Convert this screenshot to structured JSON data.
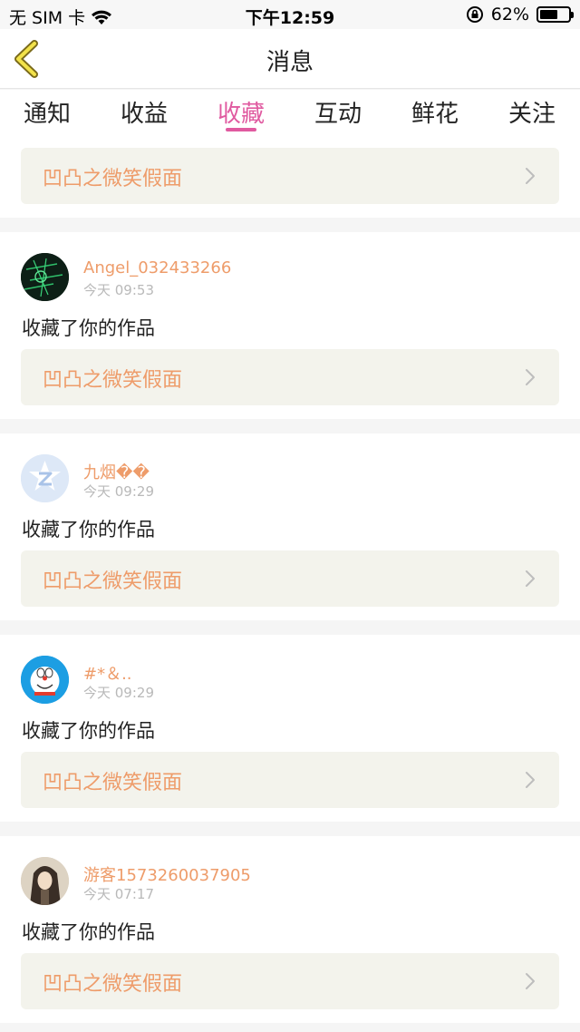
{
  "status_bar": {
    "carrier": "无 SIM 卡",
    "time": "下午12:59",
    "battery_percent": "62%",
    "battery_level": 0.62
  },
  "navbar": {
    "back_icon": "chevron-left-icon",
    "title": "消息"
  },
  "tabs": [
    {
      "label": "通知",
      "active": false
    },
    {
      "label": "收益",
      "active": false
    },
    {
      "label": "收藏",
      "active": true
    },
    {
      "label": "互动",
      "active": false
    },
    {
      "label": "鲜花",
      "active": false
    },
    {
      "label": "关注",
      "active": false
    }
  ],
  "colors": {
    "accent": "#e05aa0",
    "username": "#ee9c6a",
    "work_title": "#ee9c6a",
    "link_bg": "#f3f3ec"
  },
  "top_card": {
    "work_title": "凹凸之微笑假面"
  },
  "items": [
    {
      "username": "Angel_032433266",
      "time": "今天 09:53",
      "action": "收藏了你的作品",
      "work_title": "凹凸之微笑假面",
      "avatar_icon": "dark-green-avatar"
    },
    {
      "username": "九烟��",
      "time": "今天 09:29",
      "action": "收藏了你的作品",
      "work_title": "凹凸之微笑假面",
      "avatar_icon": "default-z-avatar"
    },
    {
      "username": "#*＆..",
      "time": "今天 09:29",
      "action": "收藏了你的作品",
      "work_title": "凹凸之微笑假面",
      "avatar_icon": "doraemon-avatar"
    },
    {
      "username": "游客1573260037905",
      "time": "今天 07:17",
      "action": "收藏了你的作品",
      "work_title": "凹凸之微笑假面",
      "avatar_icon": "anime-character-avatar"
    }
  ]
}
